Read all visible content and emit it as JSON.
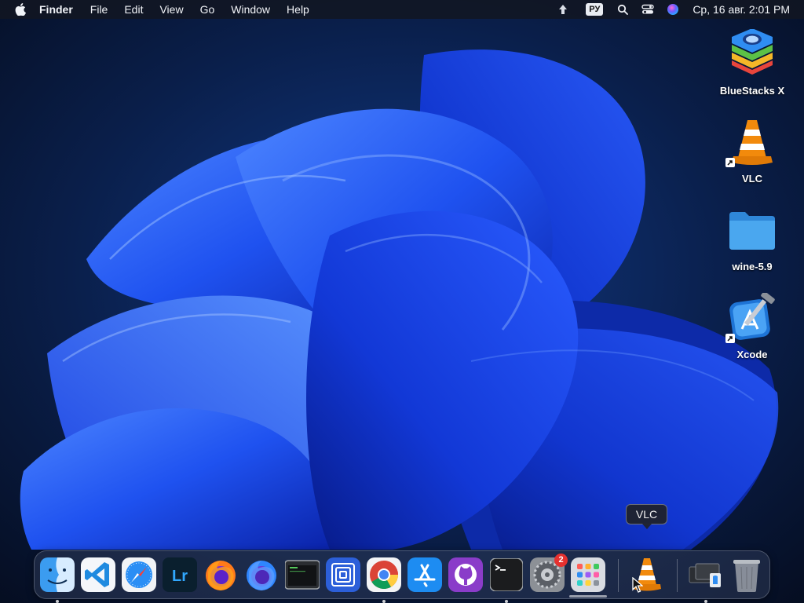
{
  "menubar": {
    "apple_icon": "apple-icon",
    "app_name": "Finder",
    "menus": [
      "File",
      "Edit",
      "View",
      "Go",
      "Window",
      "Help"
    ],
    "status": {
      "icons": [
        "upload-indicator-icon",
        "keyboard-layout-badge",
        "search-icon",
        "control-center-icon",
        "siri-icon"
      ],
      "keyboard_layout": "РУ",
      "clock": "Ср, 16 авг.  2:01 PM"
    }
  },
  "desktop": {
    "icons": [
      {
        "label": "BlueStacks X",
        "icon": "bluestacks-icon",
        "alias": false
      },
      {
        "label": "VLC",
        "icon": "vlc-cone-icon",
        "alias": true
      },
      {
        "label": "wine-5.9",
        "icon": "folder-icon",
        "alias": false
      },
      {
        "label": "Xcode",
        "icon": "xcode-icon",
        "alias": true
      }
    ]
  },
  "dock": {
    "items": [
      {
        "name": "Finder",
        "icon": "finder-icon",
        "running": true
      },
      {
        "name": "Visual Studio Code",
        "icon": "vscode-icon",
        "running": false
      },
      {
        "name": "Safari",
        "icon": "safari-icon",
        "running": false
      },
      {
        "name": "Lightroom",
        "icon": "lightroom-icon",
        "label": "Lr",
        "running": false
      },
      {
        "name": "Firefox",
        "icon": "firefox-icon",
        "running": false
      },
      {
        "name": "Firefox Developer Edition",
        "icon": "firefox-dev-icon",
        "running": false
      },
      {
        "name": "Console",
        "icon": "console-icon",
        "running": false
      },
      {
        "name": "Mission Control App",
        "icon": "squares-app-icon",
        "running": false
      },
      {
        "name": "Google Chrome",
        "icon": "chrome-icon",
        "running": true
      },
      {
        "name": "App Store",
        "icon": "app-store-icon",
        "running": false
      },
      {
        "name": "GitHub Desktop",
        "icon": "github-icon",
        "running": false
      },
      {
        "name": "Terminal",
        "icon": "terminal-icon",
        "running": true
      },
      {
        "name": "System Settings",
        "icon": "settings-gear-icon",
        "badge": "2",
        "running": false
      },
      {
        "name": "Launchpad",
        "icon": "launchpad-icon",
        "running": false
      },
      {
        "name": "VLC",
        "icon": "vlc-cone-icon",
        "running": false
      },
      {
        "name": "Photos",
        "icon": "photos-stack-icon",
        "running": false
      },
      {
        "name": "Trash",
        "icon": "trash-icon",
        "running": false
      }
    ],
    "tooltip": "VLC"
  },
  "colors": {
    "wallpaper_bg": "#08152e",
    "bloom_blue": "#1f52f0",
    "menubar_bg": "#121622",
    "folder_blue": "#3f9be6",
    "vlc_orange": "#f28a0c",
    "badge_red": "#e5312f"
  }
}
